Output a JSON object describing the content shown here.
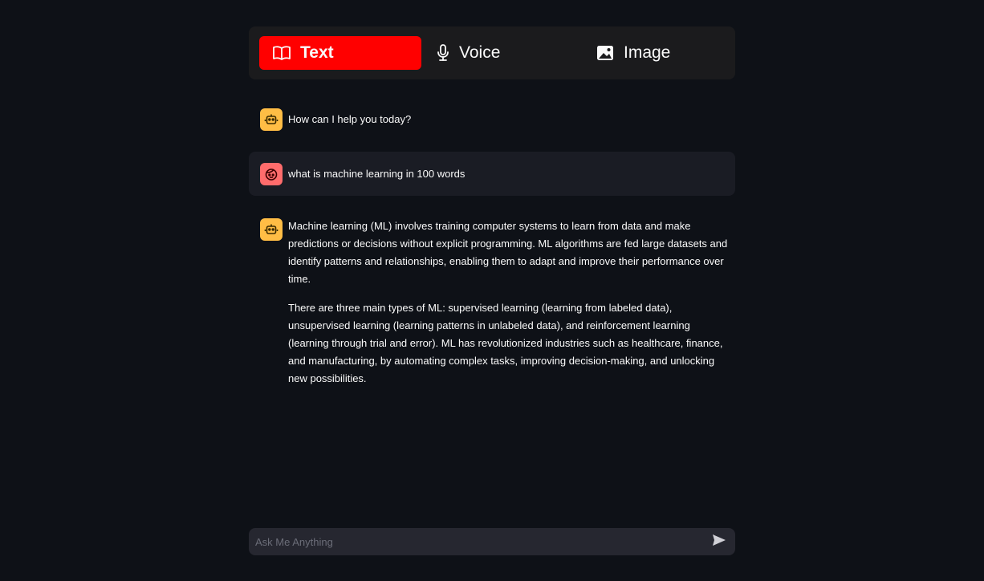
{
  "modes": {
    "text_label": "Text",
    "voice_label": "Voice",
    "image_label": "Image",
    "active": "Text",
    "active_color": "#ff0000"
  },
  "icons": {
    "text_tab": "book-open-icon",
    "voice_tab": "microphone-icon",
    "image_tab": "image-icon",
    "bot_avatar": "robot-icon",
    "user_avatar": "face-icon",
    "send": "send-icon"
  },
  "colors": {
    "background": "#0e1117",
    "bot_avatar": "#ffbd45",
    "user_avatar": "#ff6c6c",
    "user_bubble": "#1a1c24",
    "input_bg": "#262730"
  },
  "messages": [
    {
      "role": "assistant",
      "paragraphs": [
        "How can I help you today?"
      ]
    },
    {
      "role": "user",
      "paragraphs": [
        "what is machine learning in 100 words"
      ]
    },
    {
      "role": "assistant",
      "paragraphs": [
        "Machine learning (ML) involves training computer systems to learn from data and make predictions or decisions without explicit programming. ML algorithms are fed large datasets and identify patterns and relationships, enabling them to adapt and improve their performance over time.",
        "There are three main types of ML: supervised learning (learning from labeled data), unsupervised learning (learning patterns in unlabeled data), and reinforcement learning (learning through trial and error). ML has revolutionized industries such as healthcare, finance, and manufacturing, by automating complex tasks, improving decision-making, and unlocking new possibilities."
      ]
    }
  ],
  "chat_input": {
    "placeholder": "Ask Me Anything",
    "value": ""
  }
}
